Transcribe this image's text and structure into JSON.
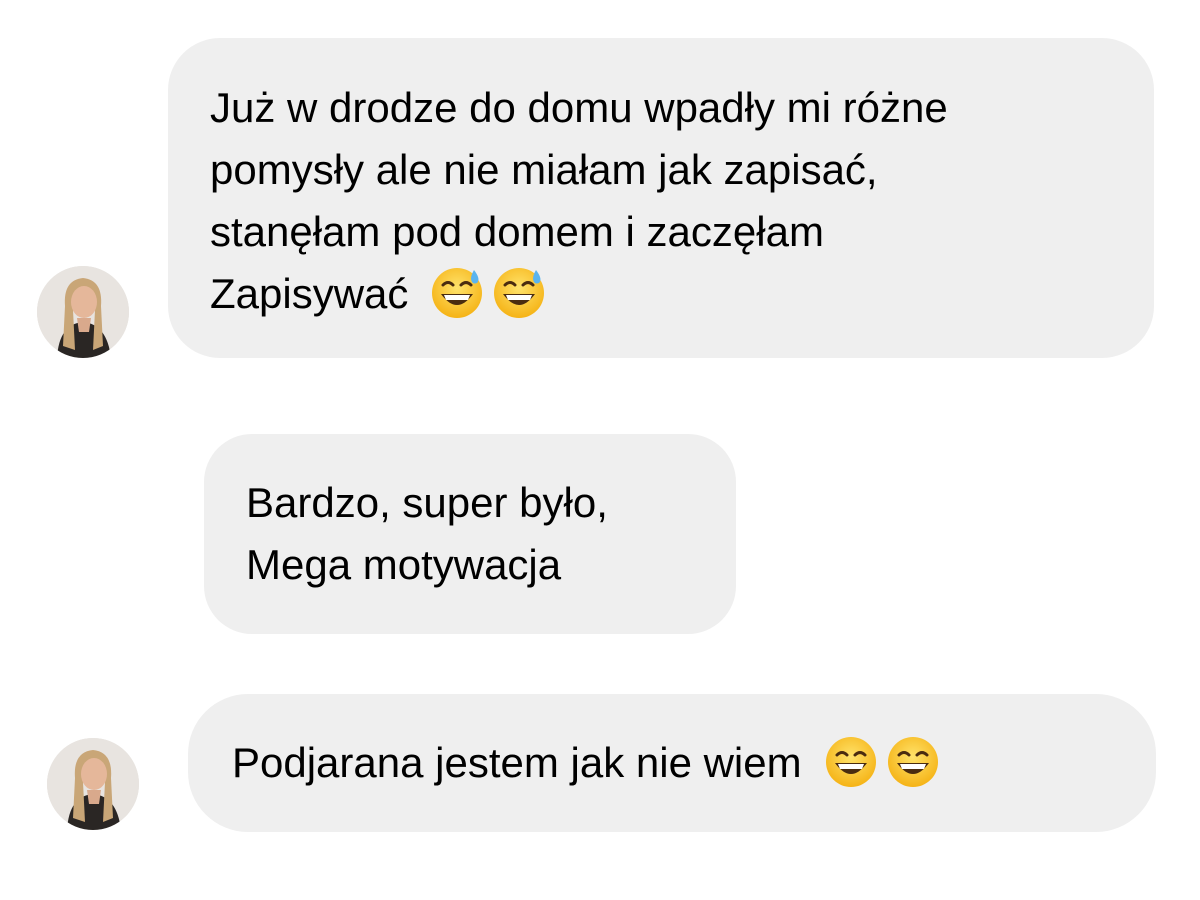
{
  "messages": [
    {
      "lines": [
        "Już w drodze do domu wpadły mi różne",
        "pomysły ale nie miałam jak zapisać,",
        "stanęłam pod domem i zaczęłam",
        "Zapisywać"
      ],
      "emojis": [
        "grinning-sweat-emoji",
        "grinning-sweat-emoji"
      ]
    },
    {
      "lines": [
        "Bardzo, super było,",
        "Mega motywacja"
      ]
    },
    {
      "lines": [
        "Podjarana jestem jak nie wiem"
      ],
      "emojis": [
        "grinning-emoji",
        "grinning-emoji"
      ]
    }
  ],
  "colors": {
    "bubble": "#efefef",
    "text": "#000000",
    "background": "#ffffff"
  }
}
